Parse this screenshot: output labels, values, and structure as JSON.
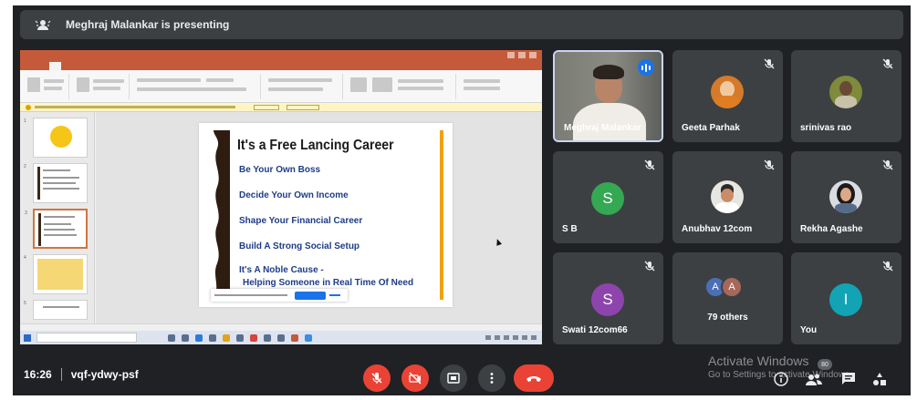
{
  "banner": {
    "presenter_text": "Meghraj Malankar is presenting"
  },
  "slide": {
    "title": "It's a Free Lancing Career",
    "bullets": [
      "Be Your Own Boss",
      "Decide Your Own Income",
      "Shape Your Financial Career",
      "Build A Strong Social Setup",
      "It's A Noble Cause -",
      "Helping Someone in Real Time Of Need"
    ]
  },
  "participants": [
    {
      "name": "Meghraj Malankar",
      "speaking": true
    },
    {
      "name": "Geeta Parhak",
      "muted": true
    },
    {
      "name": "srinivas rao",
      "muted": true
    },
    {
      "name": "S B",
      "initial": "S",
      "color": "#34a853",
      "muted": true
    },
    {
      "name": "Anubhav 12com",
      "muted": true
    },
    {
      "name": "Rekha Agashe",
      "muted": true
    },
    {
      "name": "Swati 12com66",
      "initial": "S",
      "color": "#8e44ad",
      "muted": true
    },
    {
      "name": "79 others",
      "initials": [
        "A",
        "A"
      ],
      "colors": [
        "#4a6fb3",
        "#a5685a"
      ]
    },
    {
      "name": "You",
      "initial": "I",
      "color": "#12a4b5",
      "muted": true
    }
  ],
  "footer": {
    "time": "16:26",
    "meeting_code": "vqf-ydwy-psf",
    "participant_count": "80"
  },
  "watermark": {
    "line1": "Activate Windows",
    "line2": "Go to Settings to activate Windows."
  },
  "icons": [
    "presenting-icon",
    "mic-off-icon",
    "camera-off-icon",
    "present-screen-icon",
    "more-options-icon",
    "end-call-icon",
    "info-icon",
    "people-icon",
    "chat-icon",
    "activities-icon",
    "speaking-icon"
  ],
  "colors": {
    "meet_bg": "#202124",
    "tile_bg": "#3c4043",
    "end_call": "#ea4335",
    "accent": "#1a73e8",
    "ppt": "#c55a3a"
  }
}
